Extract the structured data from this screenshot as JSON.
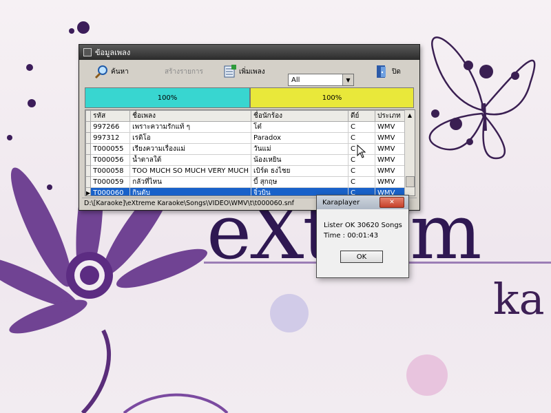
{
  "wallpaper": {
    "logo_big": "eXtrem",
    "logo_sub": "ka"
  },
  "window": {
    "title": "ข้อมูลเพลง",
    "toolbar": {
      "search_label": "ค้นหา",
      "create_list_label": "สร้างรายการ",
      "add_song_label": "เพิ่มเพลง",
      "filter_value": "All",
      "close_label": "ปิด"
    },
    "progress": {
      "left_label": "100%",
      "left_value": 100,
      "right_label": "100%",
      "right_value": 100
    },
    "table": {
      "headers": [
        "รหัส",
        "ชื่อเพลง",
        "ชื่อนักร้อง",
        "ดีย์",
        "ประเภท"
      ],
      "rows": [
        {
          "code": "997266",
          "title": "เพราะความรักแท้ ๆ",
          "artist": "โต๋",
          "key": "C",
          "type": "WMV"
        },
        {
          "code": "997312",
          "title": "เรดิโอ",
          "artist": "Paradox",
          "key": "C",
          "type": "WMV"
        },
        {
          "code": "T000055",
          "title": "เรียงความเรื่องแม่",
          "artist": "วันแม่",
          "key": "C",
          "type": "WMV"
        },
        {
          "code": "T000056",
          "title": "น้ำตาลใต้",
          "artist": "น้องเหยิน",
          "key": "C",
          "type": "WMV"
        },
        {
          "code": "T000058",
          "title": "TOO MUCH SO MUCH VERY MUCH",
          "artist": "เบิร์ด ธงไชย",
          "key": "C",
          "type": "WMV"
        },
        {
          "code": "T000059",
          "title": "กลัวที่ไหน",
          "artist": "บี้ สุกฤษ",
          "key": "C",
          "type": "WMV"
        },
        {
          "code": "T000060",
          "title": "กินตับ",
          "artist": "จิ๋วบิน",
          "key": "C",
          "type": "WMV"
        }
      ]
    },
    "status_path": "D:\\[Karaoke]\\eXtreme Karaoke\\Songs\\VIDEO\\WMV\\t\\t000060.snf"
  },
  "dialog": {
    "title": "Karaplayer",
    "line1": "Lister OK 30620 Songs",
    "line2": "Time : 00:01:43",
    "ok_label": "OK"
  },
  "colors": {
    "progress_left": "#38d6d0",
    "progress_right": "#e9e83a",
    "selection": "#1861c9"
  }
}
